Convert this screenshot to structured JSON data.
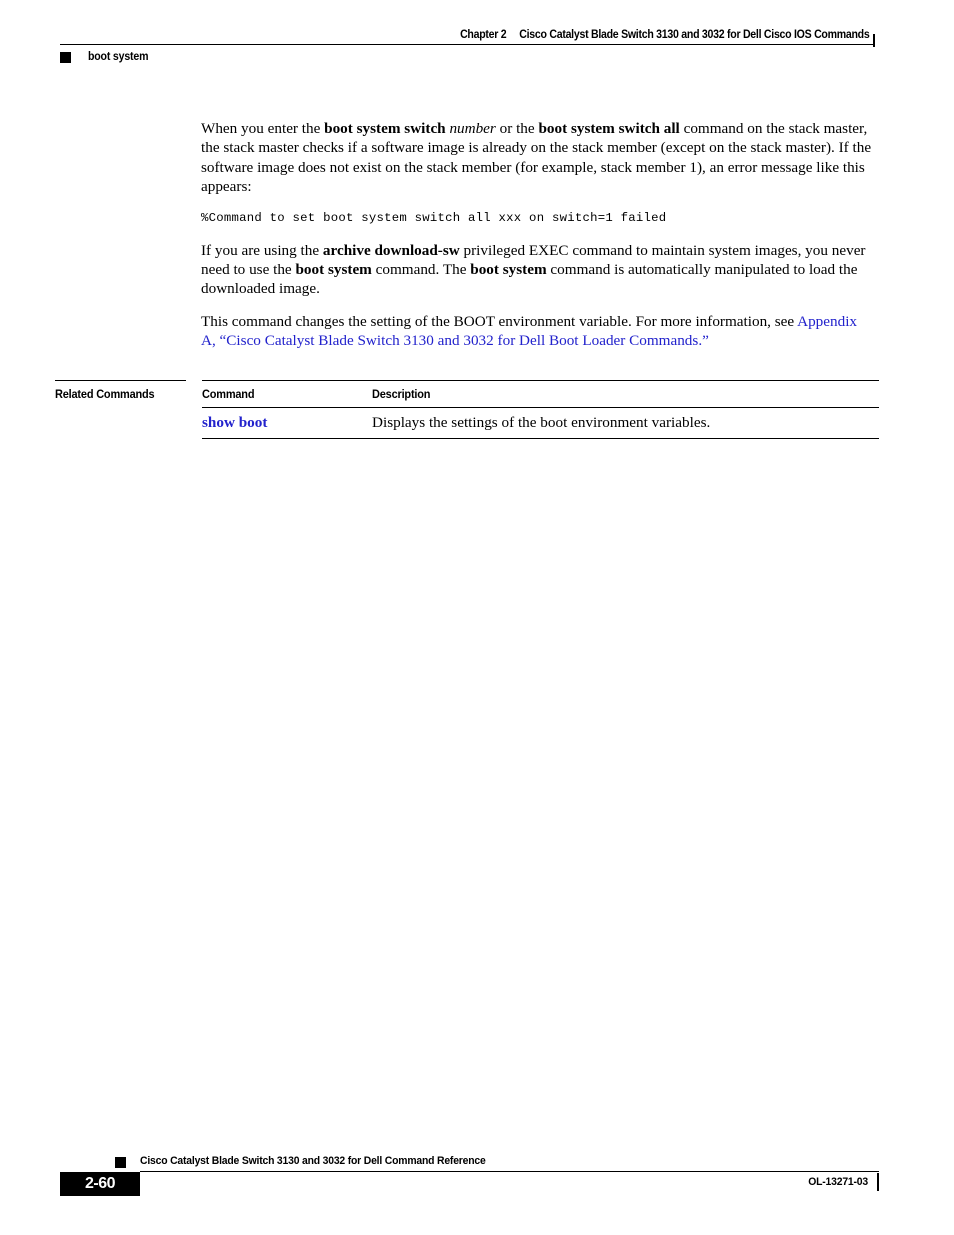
{
  "header": {
    "chapter_label": "Chapter 2",
    "chapter_title": "Cisco Catalyst Blade Switch 3130 and 3032 for Dell Cisco IOS Commands",
    "command_name": "boot system",
    "marker_icon": "black-square-marker"
  },
  "body": {
    "para1": {
      "seg1": "When you enter the ",
      "bold1": "boot system switch",
      "italic1": "number",
      "seg2": " or the ",
      "bold2": "boot system switch all",
      "seg3": " command on the stack master, the stack master checks if a software image is already on the stack member (except on the stack master). If the software image does not exist on the stack member (for example, stack member 1), an error message like this appears:"
    },
    "code": "%Command to set boot system switch all xxx on switch=1 failed",
    "para2": {
      "seg1": "If you are using the ",
      "bold1": "archive download-sw",
      "seg2": " privileged EXEC command to maintain system images, you never need to use the ",
      "bold2": "boot system",
      "seg3": " command. The ",
      "bold3": "boot system",
      "seg4": " command is automatically manipulated to load the downloaded image."
    },
    "para3": {
      "seg1": "This command changes the setting of the BOOT environment variable. For more information, see ",
      "link": "Appendix A, “Cisco Catalyst Blade Switch 3130 and 3032 for Dell Boot Loader Commands.”"
    }
  },
  "related_commands": {
    "section_label": "Related Commands",
    "columns": [
      "Command",
      "Description"
    ],
    "rows": [
      {
        "command": "show boot",
        "description": "Displays the settings of the boot environment variables."
      }
    ]
  },
  "footer": {
    "book_title": "Cisco Catalyst Blade Switch 3130 and 3032 for Dell Command Reference",
    "page_number": "2-60",
    "doc_id": "OL-13271-03",
    "marker_icon": "black-square-marker"
  },
  "colors": {
    "link": "#2222cc",
    "rule": "#000000",
    "page_background": "#ffffff"
  }
}
